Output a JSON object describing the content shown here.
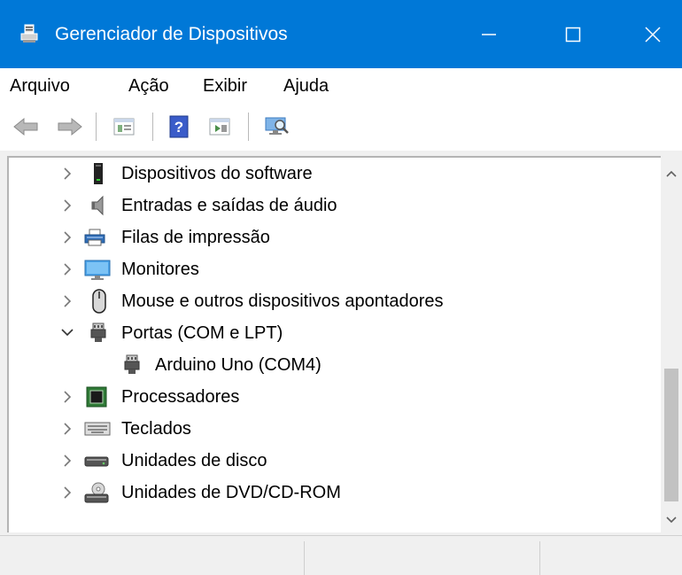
{
  "window": {
    "title": "Gerenciador de Dispositivos",
    "titlebar_color": "#0078d7"
  },
  "menu": [
    "Arquivo",
    "Ação",
    "Exibir",
    "Ajuda"
  ],
  "toolbar": {
    "buttons": [
      "back-arrow-icon",
      "forward-arrow-icon",
      "properties-icon",
      "help-icon",
      "update-driver-icon",
      "scan-hardware-icon"
    ]
  },
  "tree": {
    "items": [
      {
        "label": "Dispositivos do software",
        "expanded": false,
        "icon": "software-device-icon"
      },
      {
        "label": "Entradas e saídas de áudio",
        "expanded": false,
        "icon": "speaker-icon"
      },
      {
        "label": "Filas de impressão",
        "expanded": false,
        "icon": "printer-icon"
      },
      {
        "label": "Monitores",
        "expanded": false,
        "icon": "monitor-icon"
      },
      {
        "label": "Mouse e outros dispositivos apontadores",
        "expanded": false,
        "icon": "mouse-icon"
      },
      {
        "label": "Portas (COM e LPT)",
        "expanded": true,
        "icon": "port-icon"
      },
      {
        "label": "Arduino Uno (COM4)",
        "child": true,
        "icon": "port-icon"
      },
      {
        "label": "Processadores",
        "expanded": false,
        "icon": "processor-icon"
      },
      {
        "label": "Teclados",
        "expanded": false,
        "icon": "keyboard-icon"
      },
      {
        "label": "Unidades de disco",
        "expanded": false,
        "icon": "disk-drive-icon"
      },
      {
        "label": "Unidades de DVD/CD-ROM",
        "expanded": false,
        "icon": "dvd-drive-icon"
      }
    ]
  }
}
